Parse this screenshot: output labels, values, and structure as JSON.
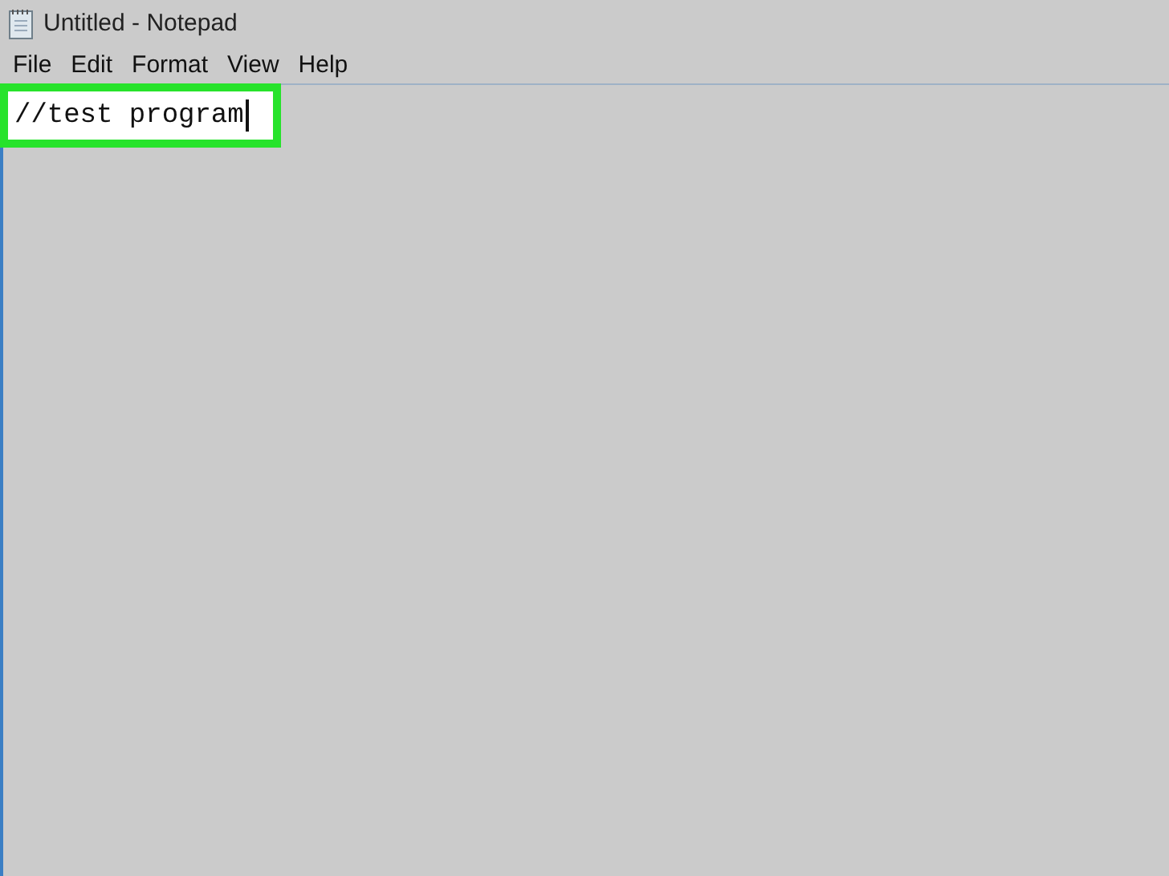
{
  "window": {
    "title": "Untitled - Notepad"
  },
  "menu": [
    {
      "label": "File"
    },
    {
      "label": "Edit"
    },
    {
      "label": "Format"
    },
    {
      "label": "View"
    },
    {
      "label": "Help"
    }
  ],
  "editor": {
    "value": "//test program",
    "caret": true,
    "highlighted": true
  }
}
